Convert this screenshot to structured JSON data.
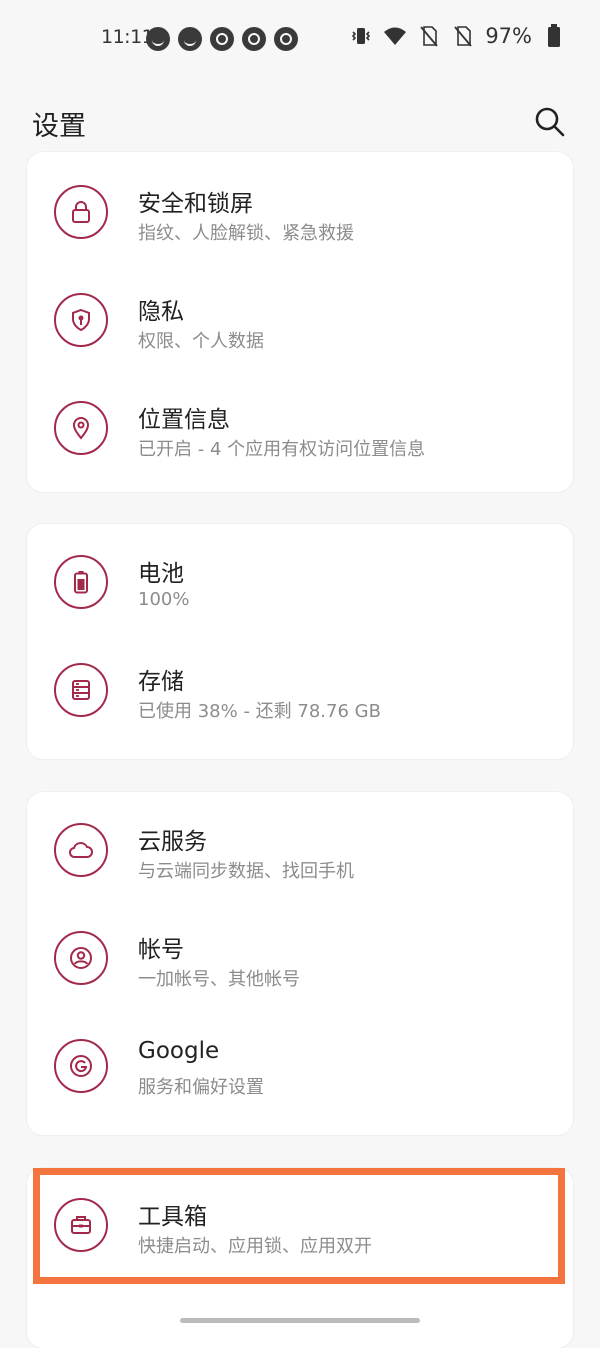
{
  "status_bar": {
    "time": "11:11",
    "notification_icons": [
      "smile-icon",
      "smile-icon",
      "q-icon",
      "q-icon",
      "q-icon"
    ],
    "right_icons": [
      "vibrate-icon",
      "wifi-icon",
      "no-sim-icon",
      "no-sim-icon"
    ],
    "battery_percent": "97%"
  },
  "header": {
    "title": "设置",
    "search_icon": "search-icon"
  },
  "colors": {
    "accent": "#a3294a",
    "highlight": "#f3743f",
    "background": "#f7f7f7",
    "card": "#ffffff",
    "subtitle": "#8c8c8c"
  },
  "groups": [
    {
      "items": [
        {
          "title": "安全和锁屏",
          "subtitle": "指纹、人脸解锁、紧急救援",
          "icon": "lock-icon"
        },
        {
          "title": "隐私",
          "subtitle": "权限、个人数据",
          "icon": "privacy-shield-icon"
        },
        {
          "title": "位置信息",
          "subtitle": "已开启 - 4 个应用有权访问位置信息",
          "icon": "location-pin-icon"
        }
      ]
    },
    {
      "items": [
        {
          "title": "电池",
          "subtitle": "100%",
          "icon": "battery-icon"
        },
        {
          "title": "存储",
          "subtitle": "已使用 38% - 还剩 78.76 GB",
          "icon": "storage-icon"
        }
      ]
    },
    {
      "items": [
        {
          "title": "云服务",
          "subtitle": "与云端同步数据、找回手机",
          "icon": "cloud-icon"
        },
        {
          "title": "帐号",
          "subtitle": "一加帐号、其他帐号",
          "icon": "account-icon"
        },
        {
          "title": "Google",
          "subtitle": "服务和偏好设置",
          "icon": "google-icon"
        }
      ]
    },
    {
      "items": [
        {
          "title": "工具箱",
          "subtitle": "快捷启动、应用锁、应用双开",
          "icon": "toolbox-icon"
        }
      ]
    }
  ]
}
